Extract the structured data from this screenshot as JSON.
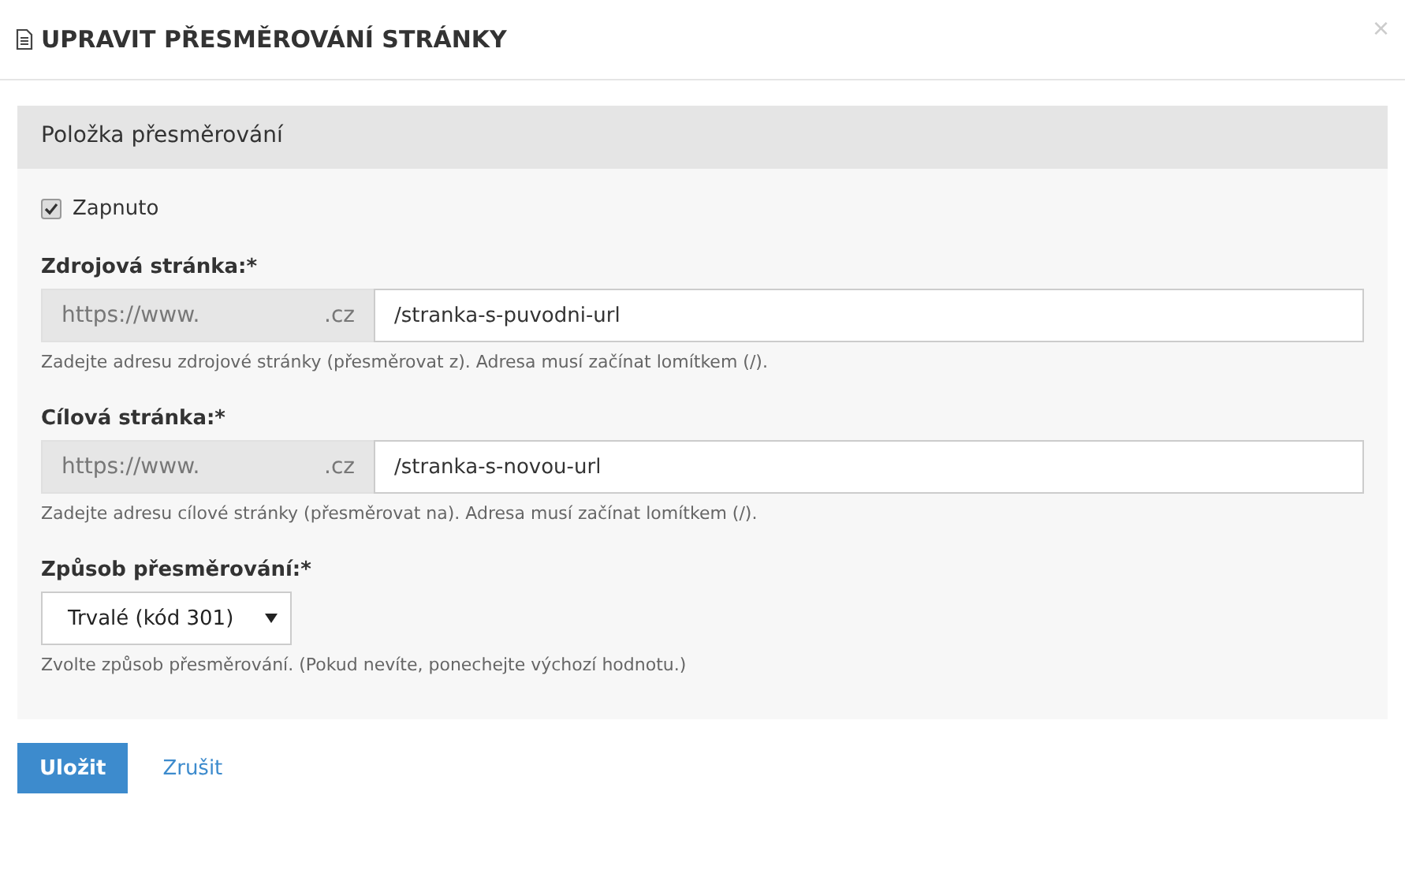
{
  "dialog": {
    "title": "UPRAVIT PŘESMĚROVÁNÍ STRÁNKY",
    "close": "×"
  },
  "panel": {
    "heading": "Položka přesměrování",
    "enabled": {
      "label": "Zapnuto",
      "checked": true
    },
    "fields": [
      {
        "label": "Zdrojová stránka:*",
        "prefix": "https://www.",
        "suffix": ".cz",
        "value": "/stranka-s-puvodni-url",
        "help": "Zadejte adresu zdrojové stránky (přesměrovat z). Adresa musí začínat lomítkem (/)."
      },
      {
        "label": "Cílová stránka:*",
        "prefix": "https://www.",
        "suffix": ".cz",
        "value": "/stranka-s-novou-url",
        "help": "Zadejte adresu cílové stránky (přesměrovat na). Adresa musí začínat lomítkem (/)."
      }
    ],
    "method": {
      "label": "Způsob přesměrování:*",
      "value": "Trvalé (kód 301)",
      "help": "Zvolte způsob přesměrování. (Pokud nevíte, ponechejte výchozí hodnotu.)"
    }
  },
  "buttons": {
    "save": "Uložit",
    "cancel": "Zrušit"
  }
}
